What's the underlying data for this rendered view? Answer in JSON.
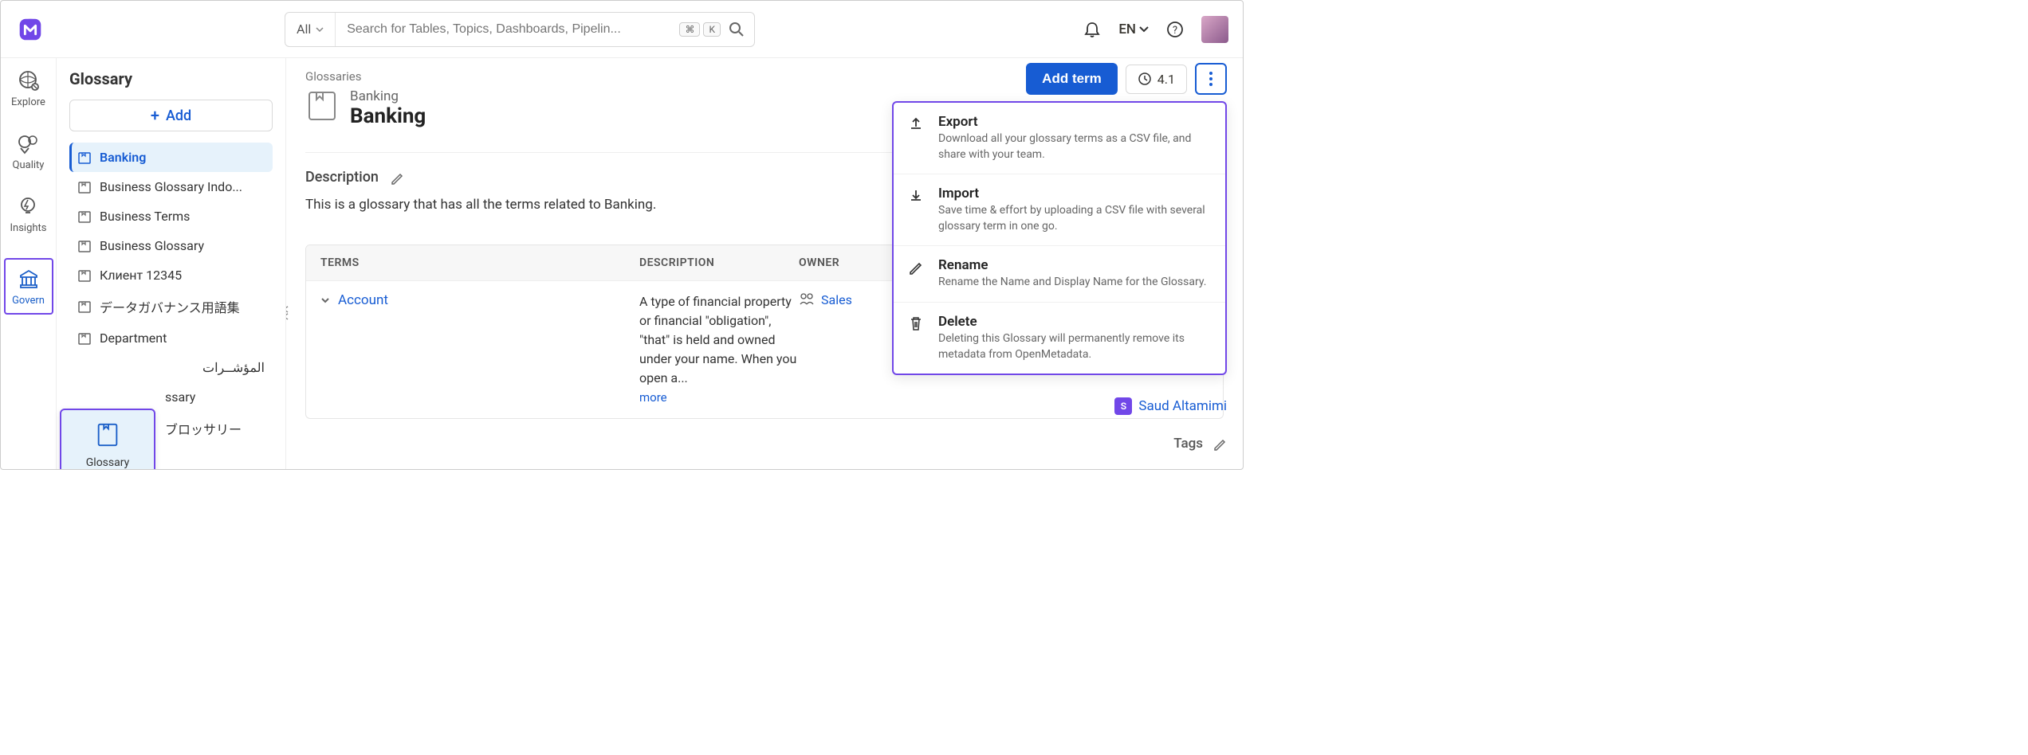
{
  "search": {
    "filter": "All",
    "placeholder": "Search for Tables, Topics, Dashboards, Pipelin...",
    "kbd1": "⌘",
    "kbd2": "K"
  },
  "lang": "EN",
  "leftnav": {
    "explore": "Explore",
    "quality": "Quality",
    "insights": "Insights",
    "govern": "Govern"
  },
  "glossary_popup": "Glossary",
  "sidebar": {
    "title": "Glossary",
    "add": "Add",
    "items": [
      "Banking",
      "Business Glossary Indo...",
      "Business Terms",
      "Business Glossary",
      "Клиент 12345",
      "データガバナンス用語集",
      "Department",
      "المؤشــرات",
      "ssary",
      "ブロッサリー"
    ]
  },
  "breadcrumb": "Glossaries",
  "header": {
    "sub": "Banking",
    "title": "Banking"
  },
  "actions": {
    "add_term": "Add term",
    "version": "4.1"
  },
  "dropdown": {
    "items": [
      {
        "title": "Export",
        "desc": "Download all your glossary terms as a CSV file, and share with your team."
      },
      {
        "title": "Import",
        "desc": "Save time & effort by uploading a CSV file with several glossary term in one go."
      },
      {
        "title": "Rename",
        "desc": "Rename the Name and Display Name for the Glossary."
      },
      {
        "title": "Delete",
        "desc": "Deleting this Glossary will permanently remove its metadata from OpenMetadata."
      }
    ]
  },
  "description": {
    "label": "Description",
    "text": "This is a glossary that has all the terms related to Banking."
  },
  "table": {
    "headers": {
      "terms": "TERMS",
      "description": "DESCRIPTION",
      "owner": "OWNER"
    },
    "rows": [
      {
        "term": "Account",
        "desc": "A type of financial property or financial \"obligation\", \"that\" is held and owned under your name. When you open a...",
        "more": "more",
        "owner": "Sales"
      }
    ]
  },
  "saud": {
    "initial": "S",
    "name": "Saud Altamimi"
  },
  "tags": "Tags"
}
